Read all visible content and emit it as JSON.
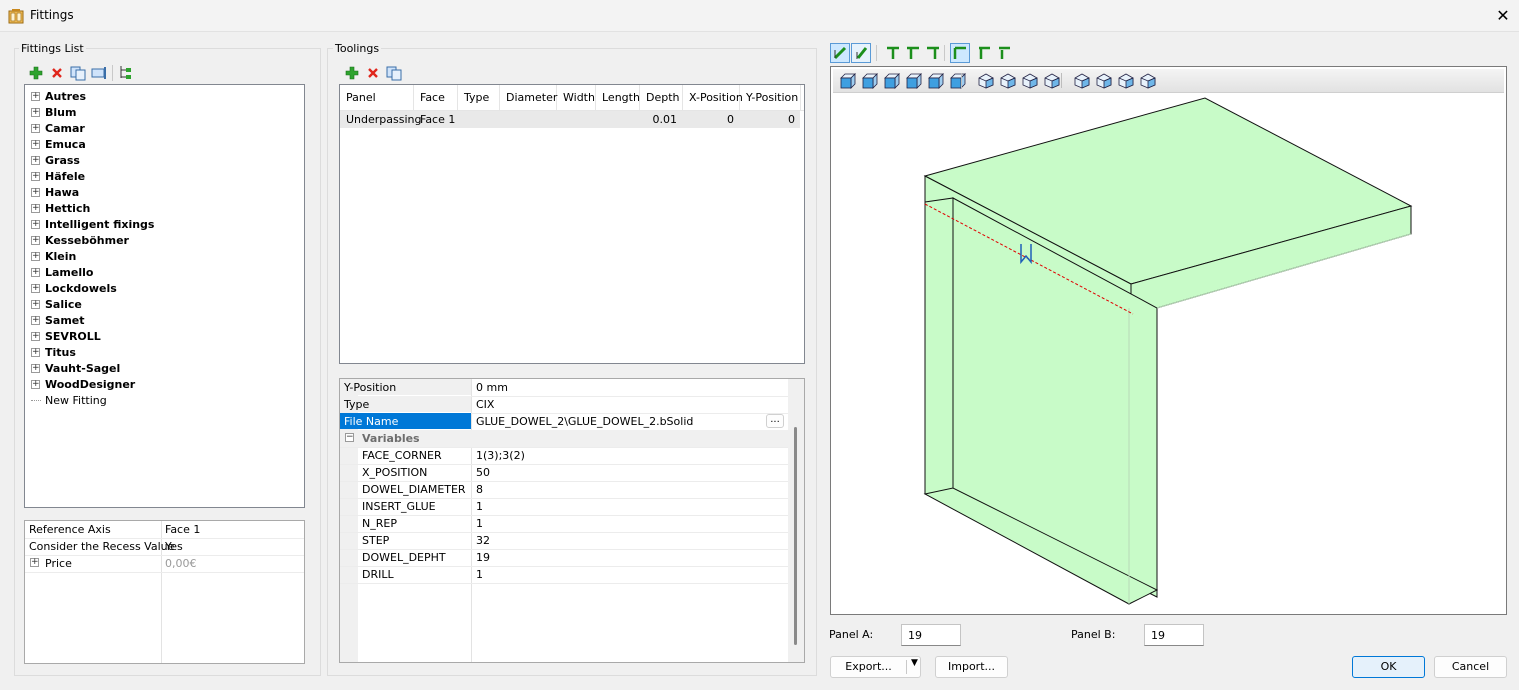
{
  "window": {
    "title": "Fittings",
    "close_glyph": "✕"
  },
  "fittings_list": {
    "label": "Fittings List",
    "toolbar": [
      {
        "name": "add-icon"
      },
      {
        "name": "delete-icon"
      },
      {
        "name": "copy-icon"
      },
      {
        "name": "rename-icon"
      },
      {
        "name": "tree-icon"
      }
    ],
    "items": [
      "Autres",
      "Blum",
      "Camar",
      "Emuca",
      "Grass",
      "Häfele",
      "Hawa",
      "Hettich",
      "Intelligent fixings",
      "Kesseböhmer",
      "Klein",
      "Lamello",
      "Lockdowels",
      "Salice",
      "Samet",
      "SEVROLL",
      "Titus",
      "Vauht-Sagel",
      "WoodDesigner"
    ],
    "new_item": "New Fitting",
    "properties": [
      {
        "key": "Reference Axis",
        "value": "Face 1"
      },
      {
        "key": "Consider the Recess Value",
        "value": "Yes"
      },
      {
        "key": "Price",
        "value": "0,00€"
      }
    ]
  },
  "toolings": {
    "label": "Toolings",
    "columns": [
      "Panel",
      "Face",
      "Type",
      "Diameter",
      "Width",
      "Length",
      "Depth",
      "X-Position",
      "Y-Position"
    ],
    "rows": [
      {
        "panel": "Underpassing",
        "face": "Face 1",
        "type": "",
        "diameter": "",
        "width": "",
        "length": "",
        "depth": "0.01",
        "x": "0",
        "y": "0"
      }
    ],
    "properties": [
      {
        "key": "Y-Position",
        "value": "0 mm"
      },
      {
        "key": "Type",
        "value": "CIX"
      },
      {
        "key": "File Name",
        "value": "GLUE_DOWEL_2\\GLUE_DOWEL_2.bSolid",
        "button": "..."
      }
    ],
    "variables_label": "Variables",
    "variables": [
      {
        "key": "FACE_CORNER",
        "value": "1(3);3(2)"
      },
      {
        "key": "X_POSITION",
        "value": "50"
      },
      {
        "key": "DOWEL_DIAMETER",
        "value": "8"
      },
      {
        "key": "INSERT_GLUE",
        "value": "1"
      },
      {
        "key": "N_REP",
        "value": "1"
      },
      {
        "key": "STEP",
        "value": "32"
      },
      {
        "key": "DOWEL_DEPHT",
        "value": "19"
      },
      {
        "key": "DRILL",
        "value": "1"
      }
    ]
  },
  "preview": {
    "colors": {
      "panel_fill": "#c8fbc8",
      "accent": "#0078d7",
      "dowel_line": "#e00000"
    },
    "panel_a_label": "Panel A:",
    "panel_a_value": "19",
    "panel_b_label": "Panel B:",
    "panel_b_value": "19"
  },
  "buttons": {
    "export": "Export...",
    "import": "Import...",
    "ok": "OK",
    "cancel": "Cancel"
  }
}
